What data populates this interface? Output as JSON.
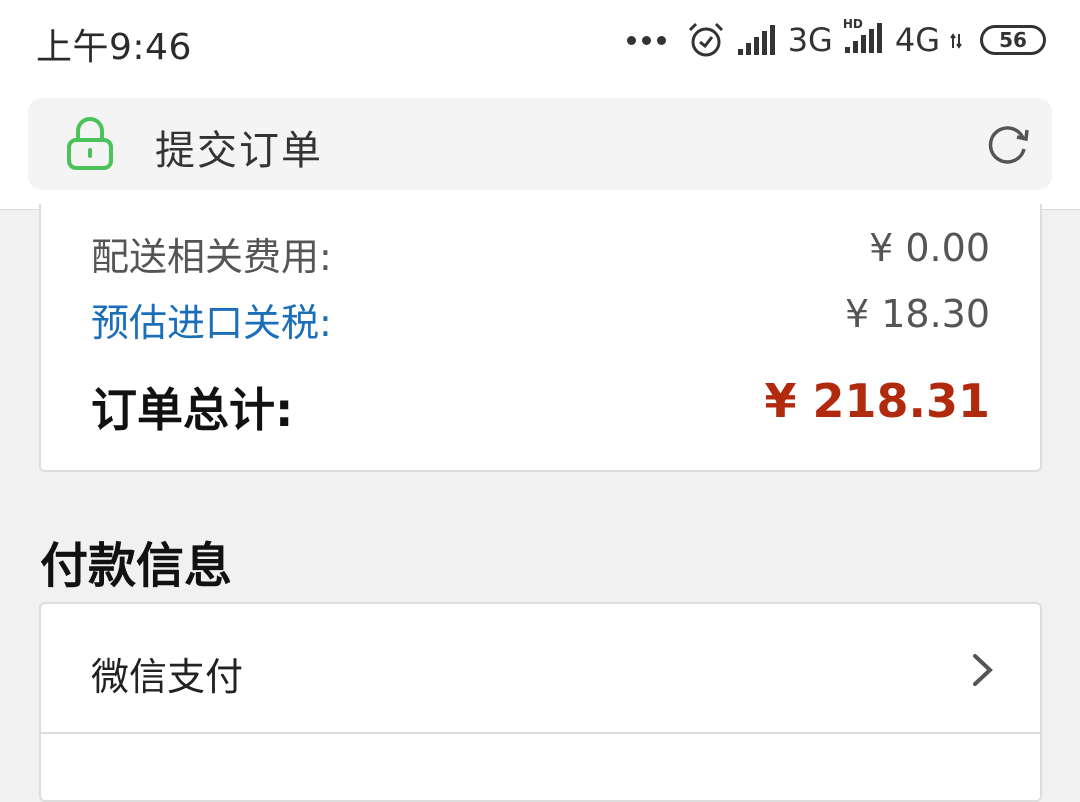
{
  "status_bar": {
    "time": "上午9:46",
    "network_1": "3G",
    "network_2": "4G",
    "hd_tag": "HD",
    "battery": "56",
    "icons": [
      "more-dots-icon",
      "alarm-icon",
      "signal-icon",
      "signal-icon",
      "data-arrows-icon",
      "battery-icon"
    ]
  },
  "address_bar": {
    "title": "提交订单",
    "secure_icon": "lock-icon",
    "reload_icon": "reload-icon",
    "secure_color": "#4cc35a"
  },
  "summary": {
    "shipping_label": "配送相关费用:",
    "shipping_value": "¥ 0.00",
    "tax_label": "预估进口关税:",
    "tax_value": "¥ 18.30",
    "total_label": "订单总计:",
    "total_value": "¥ 218.31",
    "total_color": "#b22a0e",
    "tax_link_color": "#1b6fb8"
  },
  "payment": {
    "section_title": "付款信息",
    "options": [
      {
        "label": "微信支付",
        "icon": "chevron-right-icon"
      }
    ]
  }
}
